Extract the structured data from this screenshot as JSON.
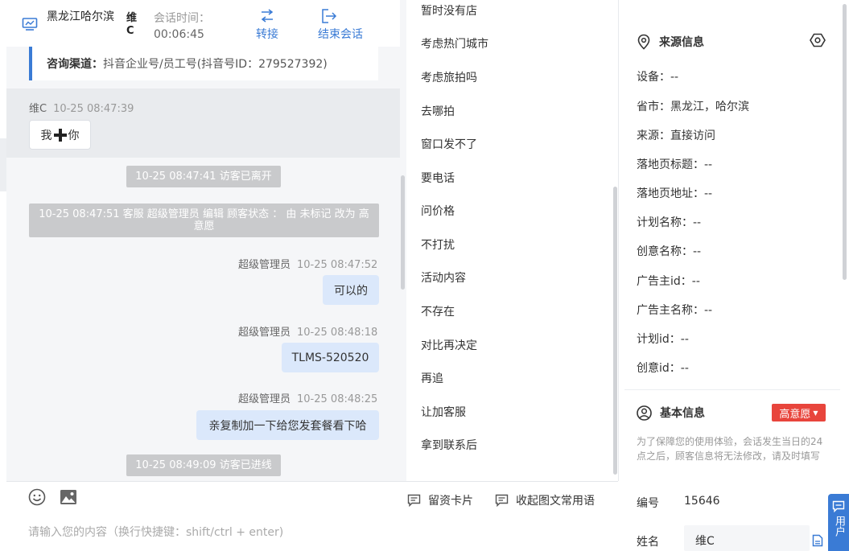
{
  "header": {
    "visitor_name": "黑龙江哈尔滨",
    "agent_short": "维C",
    "session_label": "会话时间：",
    "session_time": "00:06:45",
    "transfer_label": "转接",
    "end_label": "结束会话"
  },
  "channel": {
    "label": "咨询渠道：",
    "value": "抖音企业号/员工号(抖音号ID：279527392)"
  },
  "messages": {
    "m1": {
      "sender": "维C",
      "time": "10-25 08:47:39",
      "text_a": "我",
      "text_b": "你"
    },
    "s1": "10-25 08:47:41 访客已离开",
    "s2": "10-25 08:47:51 客服 超级管理员 编辑 顾客状态 ： 由 未标记 改为 高意愿",
    "m2": {
      "sender": "超级管理员",
      "time": "10-25 08:47:52",
      "text": "可以的"
    },
    "m3": {
      "sender": "超级管理员",
      "time": "10-25 08:48:18",
      "text": "TLMS-520520"
    },
    "m4": {
      "sender": "超级管理员",
      "time": "10-25 08:48:25",
      "text": "亲复制加一下给您发套餐看下哈"
    },
    "s3": "10-25 08:49:09 访客已进线"
  },
  "input": {
    "card_label": "留资卡片",
    "phrase_label": "收起图文常用语",
    "placeholder": "请输入您的内容（换行快捷键：shift/ctrl + enter)"
  },
  "phrases": [
    "暂时没有店",
    "考虑热门城市",
    "考虑旅拍吗",
    "去哪拍",
    "窗口发不了",
    "要电话",
    "问价格",
    "不打扰",
    "活动内容",
    "不存在",
    "对比再决定",
    "再追",
    "让加客服",
    "拿到联系后"
  ],
  "source_info": {
    "title": "来源信息",
    "rows": [
      "设备：--",
      "省市：黑龙江，哈尔滨",
      "来源：直接访问",
      "落地页标题：--",
      "落地页地址：--",
      "计划名称：--",
      "创意名称：--",
      "广告主id：--",
      "广告主名称：--",
      "计划id：--",
      "创意id：--"
    ]
  },
  "basic_info": {
    "title": "基本信息",
    "intent": "高意愿",
    "notice": "为了保障您的使用体验，会话发生当日的24点之后，顾客信息将无法修改，请及时填写",
    "id_label": "编号",
    "id_value": "15646",
    "name_label": "姓名",
    "name_value": "维C"
  },
  "user_tab": {
    "label": "用户"
  },
  "colors": {
    "accent": "#3a7bd5",
    "intent_badge": "#e8453c",
    "bubble_self": "#dbe8fb",
    "system_note": "#c9cacc"
  }
}
